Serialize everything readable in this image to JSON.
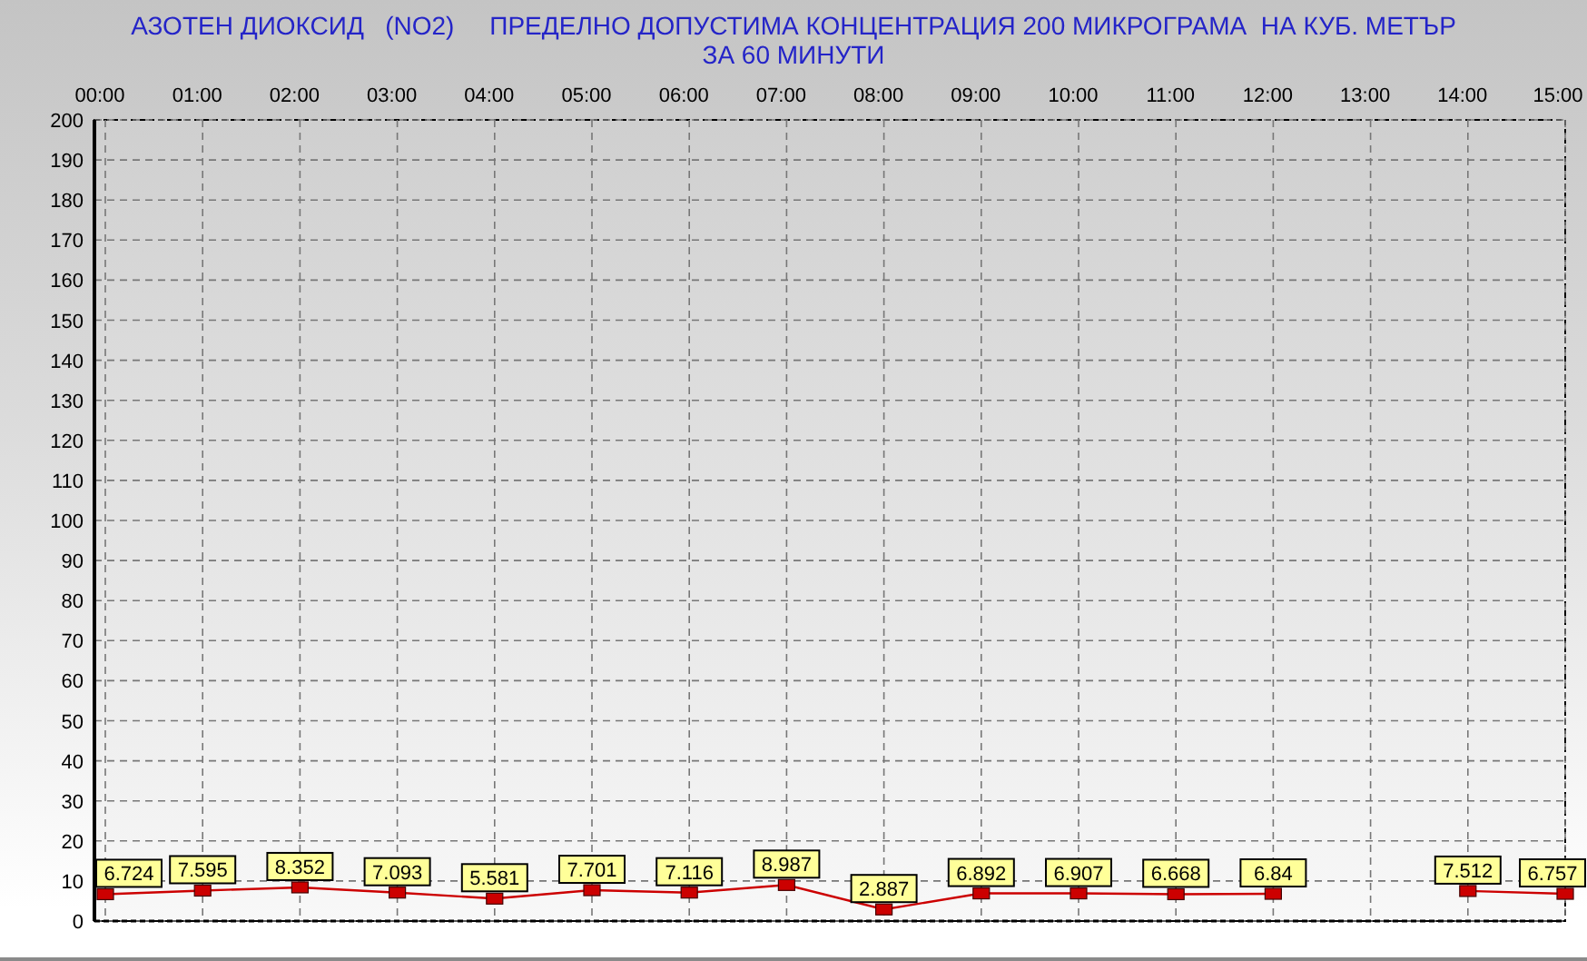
{
  "title_lines": [
    "АЗОТЕН ДИОКСИД   (NO2)     ПРЕДЕЛНО ДОПУСТИМА КОНЦЕНТРАЦИЯ 200 МИКРОГРАМА  НА КУБ. МЕТЪР",
    "ЗА 60 МИНУТИ"
  ],
  "chart": {
    "chart_data": {
      "type": "line",
      "categories": [
        "00:00",
        "01:00",
        "02:00",
        "03:00",
        "04:00",
        "05:00",
        "06:00",
        "07:00",
        "08:00",
        "09:00",
        "10:00",
        "11:00",
        "12:00",
        "13:00",
        "14:00",
        "15:00"
      ],
      "series": [
        {
          "color": "#cc0000",
          "marker": "square",
          "values": [
            6.7,
            7.6,
            8.4,
            7.1,
            5.6,
            7.7,
            7.1,
            9.0,
            2.9,
            6.9,
            6.9,
            6.7,
            6.8,
            null,
            7.5,
            6.8
          ]
        }
      ],
      "value_labels": [
        "6.724",
        "7.595",
        "8.352",
        "7.093",
        "5.581",
        "7.701",
        "7.116",
        "8.987",
        "2.887",
        "6.892",
        "6.907",
        "6.668",
        "6.84",
        null,
        "7.512",
        "6.757"
      ],
      "ylim": [
        0,
        200
      ],
      "grid": true,
      "yticks": [
        0,
        10,
        20,
        30,
        40,
        50,
        60,
        70,
        80,
        90,
        100,
        110,
        120,
        130,
        140,
        150,
        160,
        170,
        180,
        190,
        200
      ]
    }
  }
}
